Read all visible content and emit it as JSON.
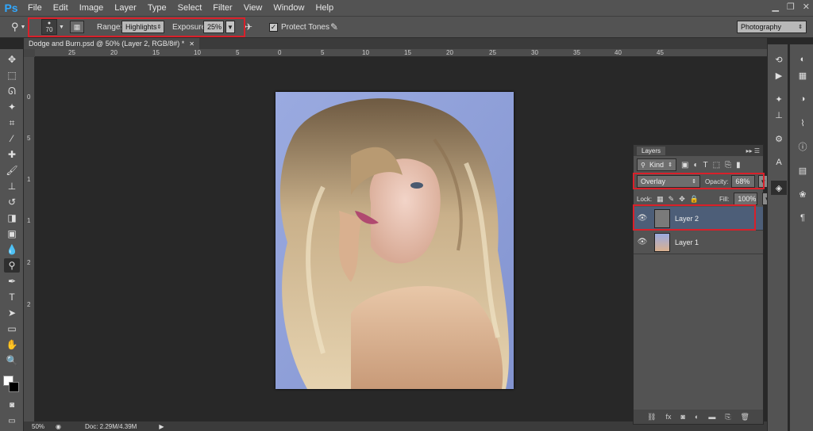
{
  "menubar": {
    "logo": "Ps",
    "items": [
      "File",
      "Edit",
      "Image",
      "Layer",
      "Type",
      "Select",
      "Filter",
      "View",
      "Window",
      "Help"
    ]
  },
  "options_bar": {
    "brush_size": "70",
    "range_label": "Range:",
    "range_value": "Highlights",
    "exposure_label": "Exposure:",
    "exposure_value": "25%",
    "protect_tones_label": "Protect Tones",
    "protect_tones_checked": true,
    "workspace": "Photography"
  },
  "document": {
    "tab_title": "Dodge and Burn.psd @ 50% (Layer 2, RGB/8#) *",
    "ruler_h_labels": [
      "25",
      "20",
      "15",
      "10",
      "5",
      "0",
      "5",
      "10",
      "15",
      "20",
      "25",
      "30",
      "35",
      "40",
      "45"
    ],
    "ruler_v_labels": [
      "0",
      "5",
      "1",
      "1",
      "2",
      "2"
    ]
  },
  "status": {
    "zoom": "50%",
    "doc_size": "Doc: 2.29M/4.39M"
  },
  "layers_panel": {
    "title": "Layers",
    "filter_kind": "Kind",
    "blend_mode": "Overlay",
    "opacity_label": "Opacity:",
    "opacity_value": "68%",
    "lock_label": "Lock:",
    "fill_label": "Fill:",
    "fill_value": "100%",
    "layers": [
      {
        "name": "Layer 2",
        "selected": true
      },
      {
        "name": "Layer 1",
        "selected": false
      }
    ]
  },
  "colors": {
    "accent_highlight": "#d9202a",
    "selected_layer": "#4d5e78",
    "photo_background": "#8f9fd6"
  }
}
